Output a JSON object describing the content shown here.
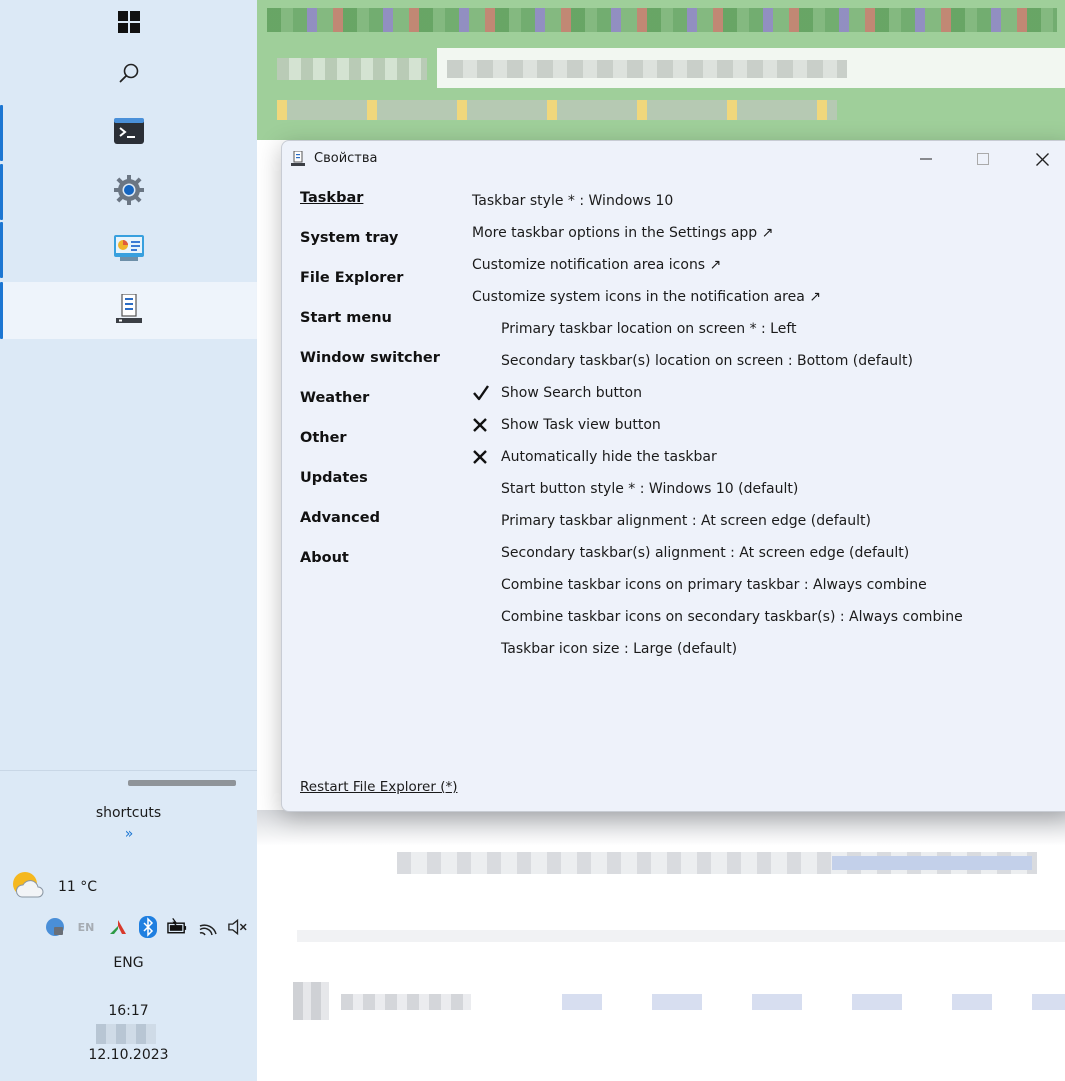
{
  "window": {
    "title": "Свойства",
    "controls": {
      "minimize": "—",
      "maximize": "☐",
      "close": "✕"
    }
  },
  "nav": {
    "items": [
      {
        "label": "Taskbar",
        "active": true
      },
      {
        "label": "System tray"
      },
      {
        "label": "File Explorer"
      },
      {
        "label": "Start menu"
      },
      {
        "label": "Window switcher"
      },
      {
        "label": "Weather"
      },
      {
        "label": "Other"
      },
      {
        "label": "Updates"
      },
      {
        "label": "Advanced"
      },
      {
        "label": "About"
      }
    ]
  },
  "settings": {
    "rows": [
      {
        "text": "Taskbar style * : Windows 10",
        "indent": false,
        "state": "none"
      },
      {
        "text": "More taskbar options in the Settings app ↗",
        "indent": false,
        "state": "none"
      },
      {
        "text": "Customize notification area icons ↗",
        "indent": false,
        "state": "none"
      },
      {
        "text": "Customize system icons in the notification area ↗",
        "indent": false,
        "state": "none"
      },
      {
        "text": "Primary taskbar location on screen * : Left",
        "indent": true,
        "state": "none"
      },
      {
        "text": "Secondary taskbar(s) location on screen : Bottom (default)",
        "indent": true,
        "state": "none"
      },
      {
        "text": "Show Search button",
        "indent": true,
        "state": "check"
      },
      {
        "text": "Show Task view button",
        "indent": true,
        "state": "cross"
      },
      {
        "text": "Automatically hide the taskbar",
        "indent": true,
        "state": "cross"
      },
      {
        "text": "Start button style * : Windows 10 (default)",
        "indent": true,
        "state": "none"
      },
      {
        "text": "Primary taskbar alignment : At screen edge (default)",
        "indent": true,
        "state": "none"
      },
      {
        "text": "Secondary taskbar(s) alignment : At screen edge (default)",
        "indent": true,
        "state": "none"
      },
      {
        "text": "Combine taskbar icons on primary taskbar : Always combine",
        "indent": true,
        "state": "none"
      },
      {
        "text": "Combine taskbar icons on secondary taskbar(s) : Always combine",
        "indent": true,
        "state": "none"
      },
      {
        "text": "Taskbar icon size : Large (default)",
        "indent": true,
        "state": "none"
      }
    ],
    "restart_link": "Restart File Explorer (*)"
  },
  "taskbar": {
    "icons": [
      {
        "name": "start-windows-icon"
      },
      {
        "name": "search-icon"
      },
      {
        "name": "terminal-icon"
      },
      {
        "name": "settings-gear-icon"
      },
      {
        "name": "control-panel-icon"
      },
      {
        "name": "properties-app-icon"
      }
    ],
    "shortcuts_label": "shortcuts",
    "shortcuts_chevron": "»",
    "weather_temp": "11 °C",
    "tray_lang_short": "EN",
    "language": "ENG",
    "time": "16:17",
    "date": "12.10.2023"
  },
  "colors": {
    "accent": "#1c76d2",
    "taskbar_bg": "#dce9f6",
    "window_bg": "#eef2fa"
  }
}
